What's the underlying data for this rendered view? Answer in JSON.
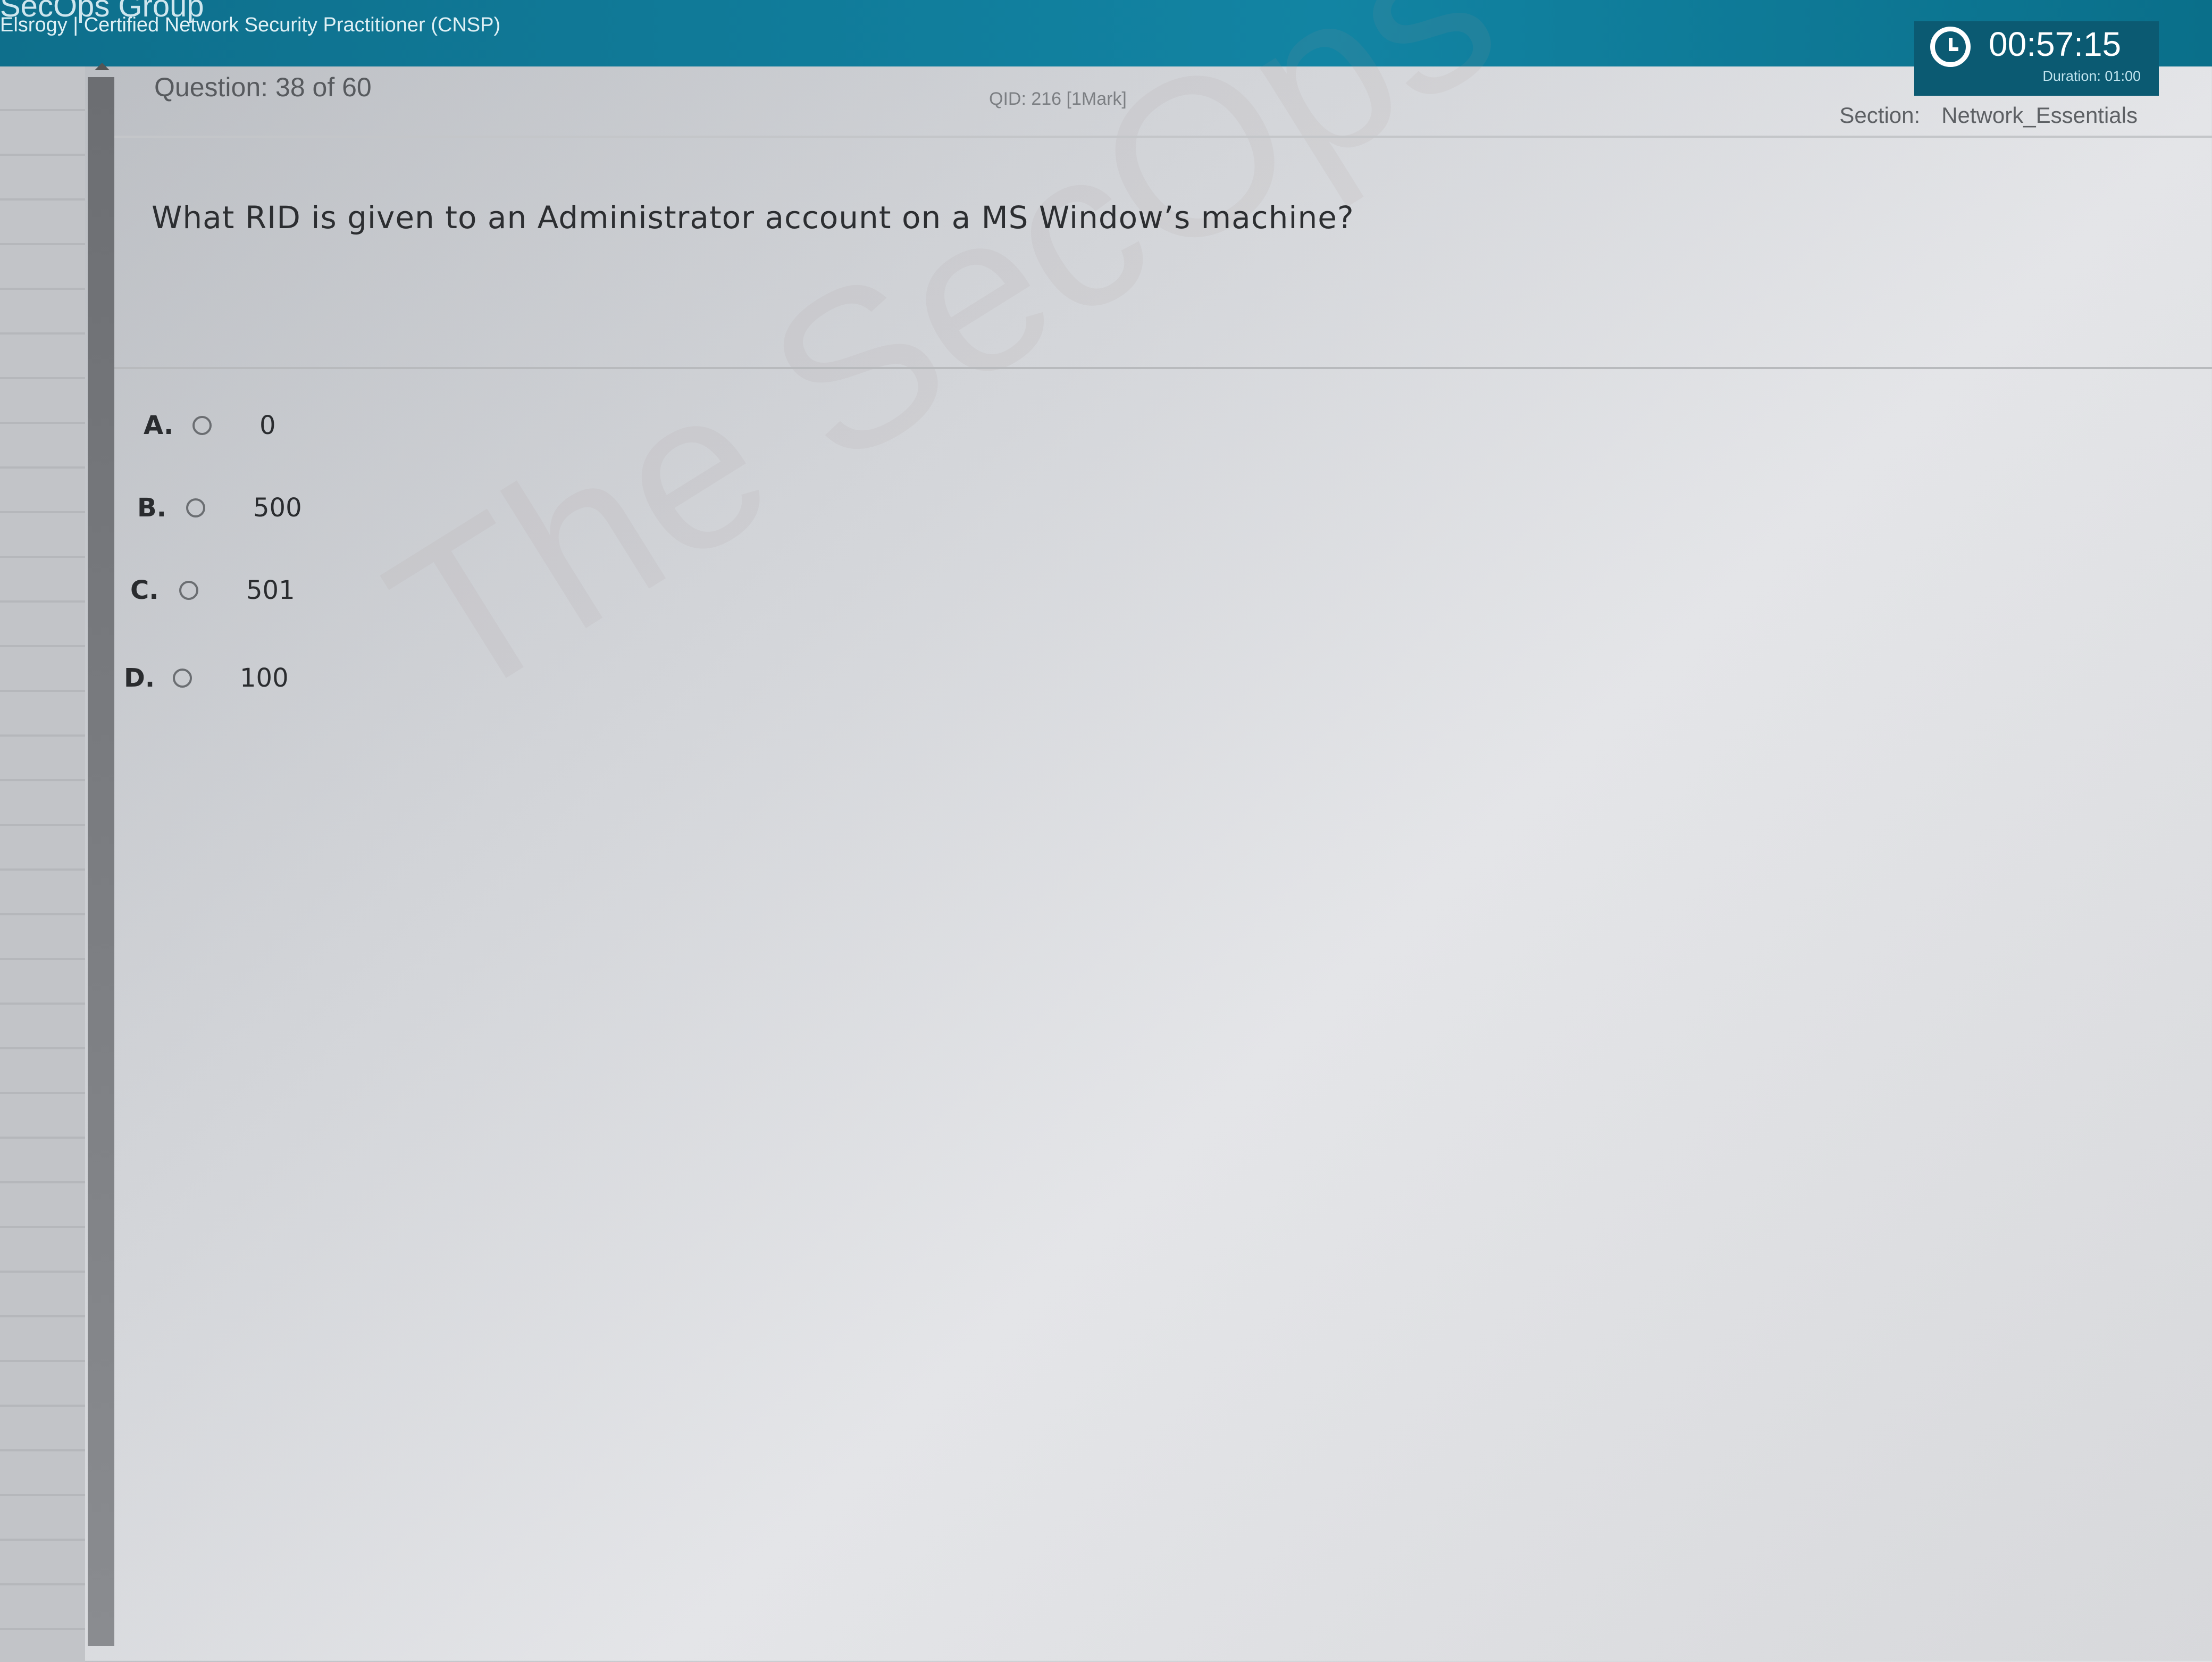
{
  "header": {
    "brand": "SecOps Group",
    "exam_title": "Elsrogy | Certified Network Security Practitioner (CNSP)"
  },
  "timer": {
    "icon": "clock-icon",
    "remaining": "00:57:15",
    "duration_label": "Duration: 01:00"
  },
  "question_bar": {
    "label": "Question:",
    "counter": "38 of 60",
    "qid": "QID: 216  [1Mark]",
    "section_label": "Section:",
    "section_name": "Network_Essentials"
  },
  "question": {
    "text": "What RID is given to an Administrator account on a MS Window’s machine?"
  },
  "options": [
    {
      "letter": "A.",
      "text": "0",
      "selected": false
    },
    {
      "letter": "B.",
      "text": "500",
      "selected": false
    },
    {
      "letter": "C.",
      "text": "501",
      "selected": false
    },
    {
      "letter": "D.",
      "text": "100",
      "selected": false
    }
  ],
  "watermark": "The SecOps Group",
  "colors": {
    "header_teal": "#1284a3",
    "timer_bg": "#0b5a72",
    "page_bg": "#d3d5d9"
  }
}
